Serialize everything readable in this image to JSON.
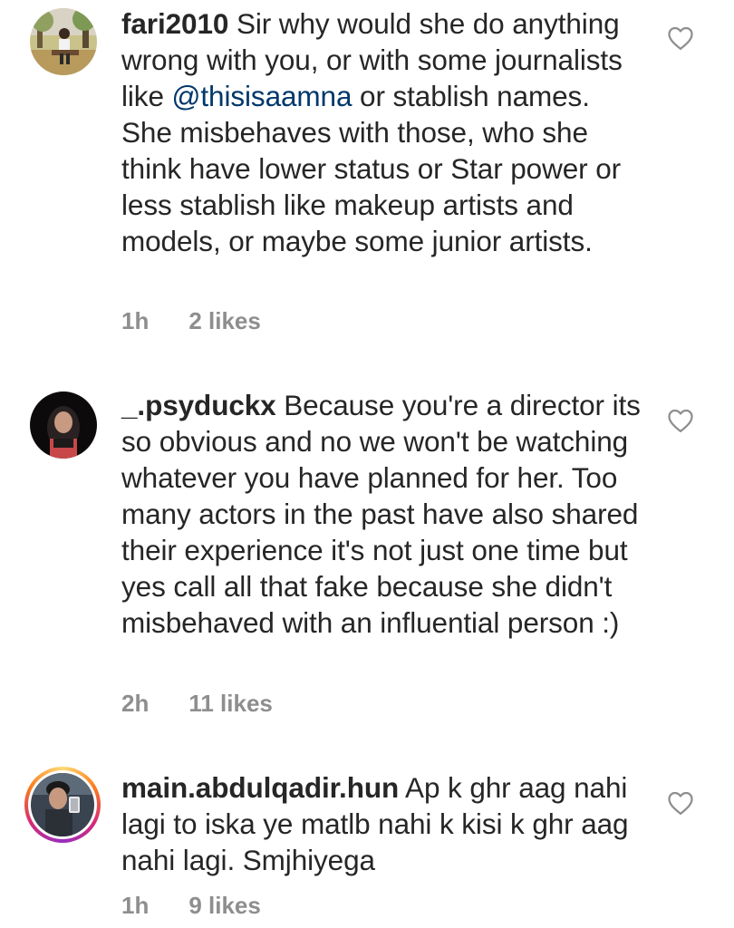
{
  "comments": [
    {
      "username": "fari2010",
      "text_before_mention": " Sir why would she do anything wrong with you, or with some  journalists like ",
      "mention": "@thisisaamna",
      "text_after_mention": " or stablish names. She  misbehaves with those, who she think have lower status or Star power or less stablish like makeup artists and models, or maybe some junior artists.",
      "time": "1h",
      "likes": "2 likes",
      "avatar_icon": "avatar-photo",
      "like_icon": "heart-outline-icon"
    },
    {
      "username": "_.psyduckx",
      "text_before_mention": " Because you're a director its so obvious and no we won't be watching whatever you have planned for her. Too many actors in the past have also shared their experience it's not just one time but yes call all that fake because she didn't misbehaved with an influential person :)",
      "mention": "",
      "text_after_mention": "",
      "time": "2h",
      "likes": "11 likes",
      "avatar_icon": "avatar-photo",
      "like_icon": "heart-outline-icon"
    },
    {
      "username": "main.abdulqadir.hun",
      "text_before_mention": " Ap k ghr aag nahi lagi to iska ye matlb nahi k kisi k ghr aag nahi lagi. Smjhiyega",
      "mention": "",
      "text_after_mention": "",
      "time": "1h",
      "likes": "9 likes",
      "avatar_icon": "avatar-photo-with-story-ring",
      "like_icon": "heart-outline-icon"
    }
  ],
  "colors": {
    "text": "#262626",
    "meta": "#8e8e8e",
    "mention": "#00376b",
    "heart_stroke": "#8e8e8e"
  }
}
